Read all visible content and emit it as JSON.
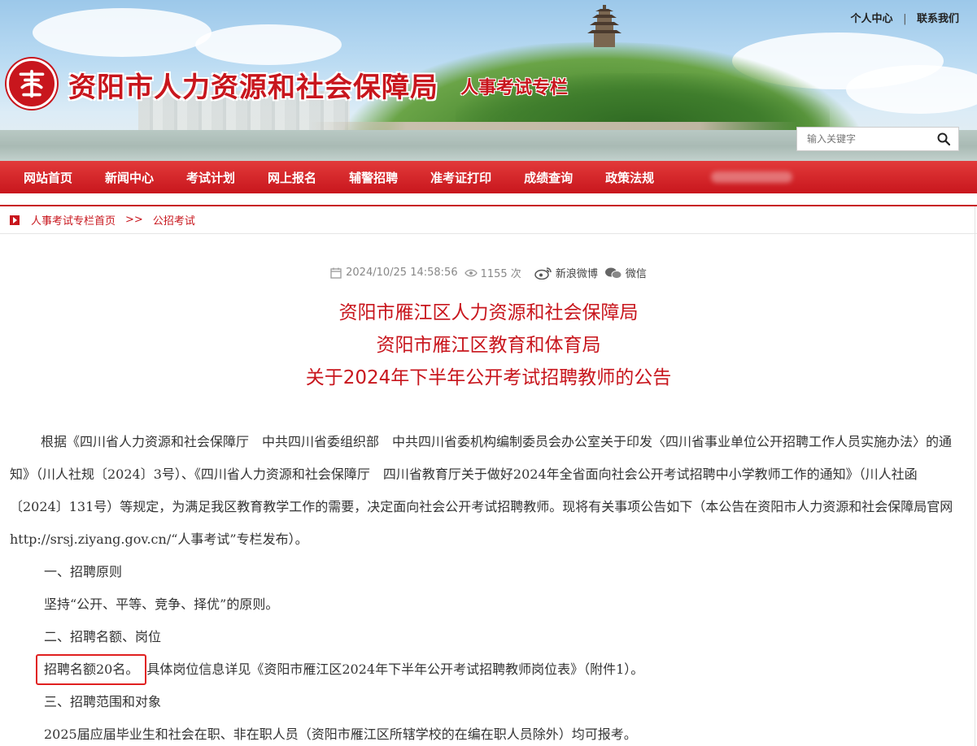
{
  "header": {
    "site_title": "资阳市人力资源和社会保障局",
    "site_subtitle": "人事考试专栏",
    "links": [
      "个人中心",
      "联系我们"
    ],
    "link_separator": "|"
  },
  "search": {
    "placeholder": "输入关键字",
    "icon": "search-icon"
  },
  "nav": {
    "items": [
      "网站首页",
      "新闻中心",
      "考试计划",
      "网上报名",
      "辅警招聘",
      "准考证打印",
      "成绩查询",
      "政策法规"
    ]
  },
  "breadcrumb": {
    "items": [
      "人事考试专栏首页",
      "公招考试"
    ],
    "separator": ">>"
  },
  "article": {
    "meta": {
      "datetime": "2024/10/25 14:58:56",
      "views": "1155 次",
      "share_weibo": "新浪微博",
      "share_wechat": "微信"
    },
    "title_lines": [
      "资阳市雁江区人力资源和社会保障局",
      "资阳市雁江区教育和体育局",
      "关于2024年下半年公开考试招聘教师的公告"
    ],
    "intro": "根据《四川省人力资源和社会保障厅　中共四川省委组织部　中共四川省委机构编制委员会办公室关于印发〈四川省事业单位公开招聘工作人员实施办法〉的通知》（川人社规〔2024〕3号）、《四川省人力资源和社会保障厅　四川省教育厅关于做好2024年全省面向社会公开考试招聘中小学教师工作的通知》（川人社函〔2024〕131号）等规定，为满足我区教育教学工作的需要，决定面向社会公开考试招聘教师。现将有关事项公告如下（本公告在资阳市人力资源和社会保障局官网http://srsj.ziyang.gov.cn/“人事考试”专栏发布）。",
    "section1_heading": "一、招聘原则",
    "section1_text": "坚持“公开、平等、竞争、择优”的原则。",
    "section2_heading": "二、招聘名额、岗位",
    "section2_highlight": "招聘名额20名。",
    "section2_rest": "具体岗位信息详见《资阳市雁江区2024年下半年公开考试招聘教师岗位表》（附件1）。",
    "section3_heading": "三、招聘范围和对象",
    "section3_text": "2025届应届毕业生和社会在职、非在职人员（资阳市雁江区所辖学校的在编在职人员除外）均可报考。"
  },
  "colors": {
    "brand_red": "#c8161d",
    "highlight_box": "#e02020"
  }
}
